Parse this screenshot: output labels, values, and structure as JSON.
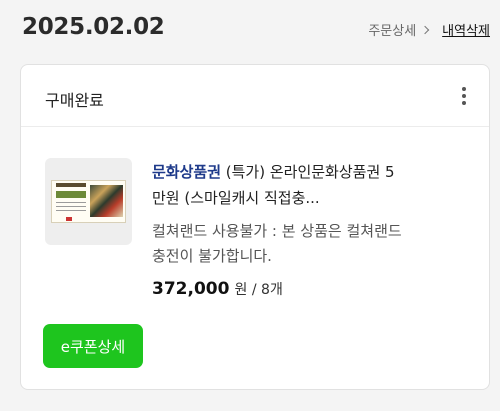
{
  "order": {
    "date": "2025.02.02",
    "detail_link": "주문상세",
    "delete_link": "내역삭제"
  },
  "card": {
    "status": "구매완료",
    "more_icon": "more-vertical-icon",
    "product": {
      "brand": "문화상품권",
      "title_rest": " (특가) 온라인문화상품권 5만원 (스마일캐시 직접충...",
      "notice": "컬쳐랜드 사용불가 : 본 상품은 컬쳐랜드 충전이 불가합니다.",
      "price": "372,000",
      "price_unit": "원",
      "quantity": " / 8개"
    },
    "coupon_button": "e쿠폰상세"
  },
  "colors": {
    "accent_green": "#1ec51e",
    "brand_blue": "#1e3a8a"
  }
}
